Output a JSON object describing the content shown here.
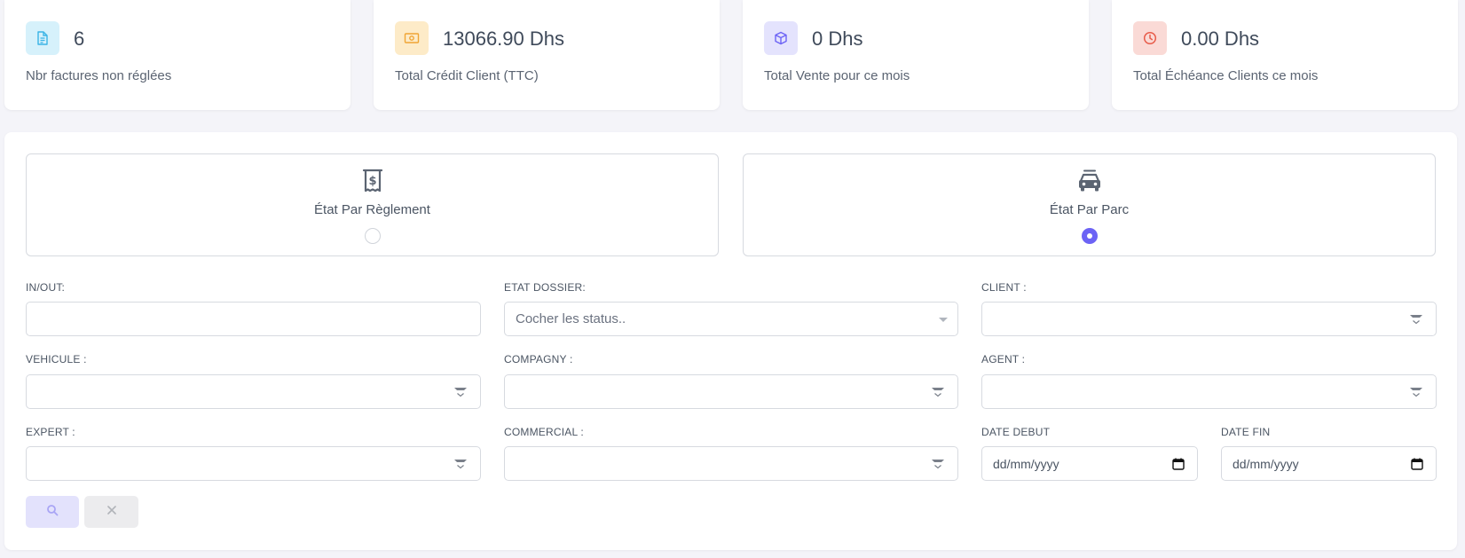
{
  "stats": [
    {
      "value": "6",
      "label": "Nbr factures non réglées",
      "icon": "document-icon",
      "bg": "#d6f1fb",
      "fg": "#3bb4e6"
    },
    {
      "value": "13066.90 Dhs",
      "label": "Total Crédit Client (TTC)",
      "icon": "money-icon",
      "bg": "#fdebc8",
      "fg": "#f0a534"
    },
    {
      "value": "0 Dhs",
      "label": "Total Vente pour ce mois",
      "icon": "box-icon",
      "bg": "#e4e3fd",
      "fg": "#6c63f5"
    },
    {
      "value": "0.00 Dhs",
      "label": "Total Échéance Clients ce mois",
      "icon": "clock-icon",
      "bg": "#fadad6",
      "fg": "#e85c4a"
    }
  ],
  "options": {
    "reglement": {
      "label": "État Par Règlement",
      "checked": false
    },
    "parc": {
      "label": "État Par Parc",
      "checked": true
    }
  },
  "filters": {
    "inout": {
      "label": "IN/OUT:",
      "value": ""
    },
    "etat_dossier": {
      "label": "ETAT DOSSIER:",
      "placeholder": "Cocher les status.."
    },
    "client": {
      "label": "CLIENT :",
      "value": ""
    },
    "vehicule": {
      "label": "VEHICULE :",
      "value": ""
    },
    "compagny": {
      "label": "COMPAGNY :",
      "value": ""
    },
    "agent": {
      "label": "AGENT :",
      "value": ""
    },
    "expert": {
      "label": "EXPERT :",
      "value": ""
    },
    "commercial": {
      "label": "COMMERCIAL :",
      "value": ""
    },
    "date_debut": {
      "label": "DATE DEBUT",
      "placeholder": "dd/mm/yyyy"
    },
    "date_fin": {
      "label": "DATE FIN",
      "placeholder": "dd/mm/yyyy"
    }
  },
  "buttons": {
    "search": {
      "icon": "search-icon"
    },
    "reset": {
      "icon": "close-icon"
    }
  },
  "colors": {
    "accent": "#6c63f5",
    "background": "#f4f4f9"
  }
}
